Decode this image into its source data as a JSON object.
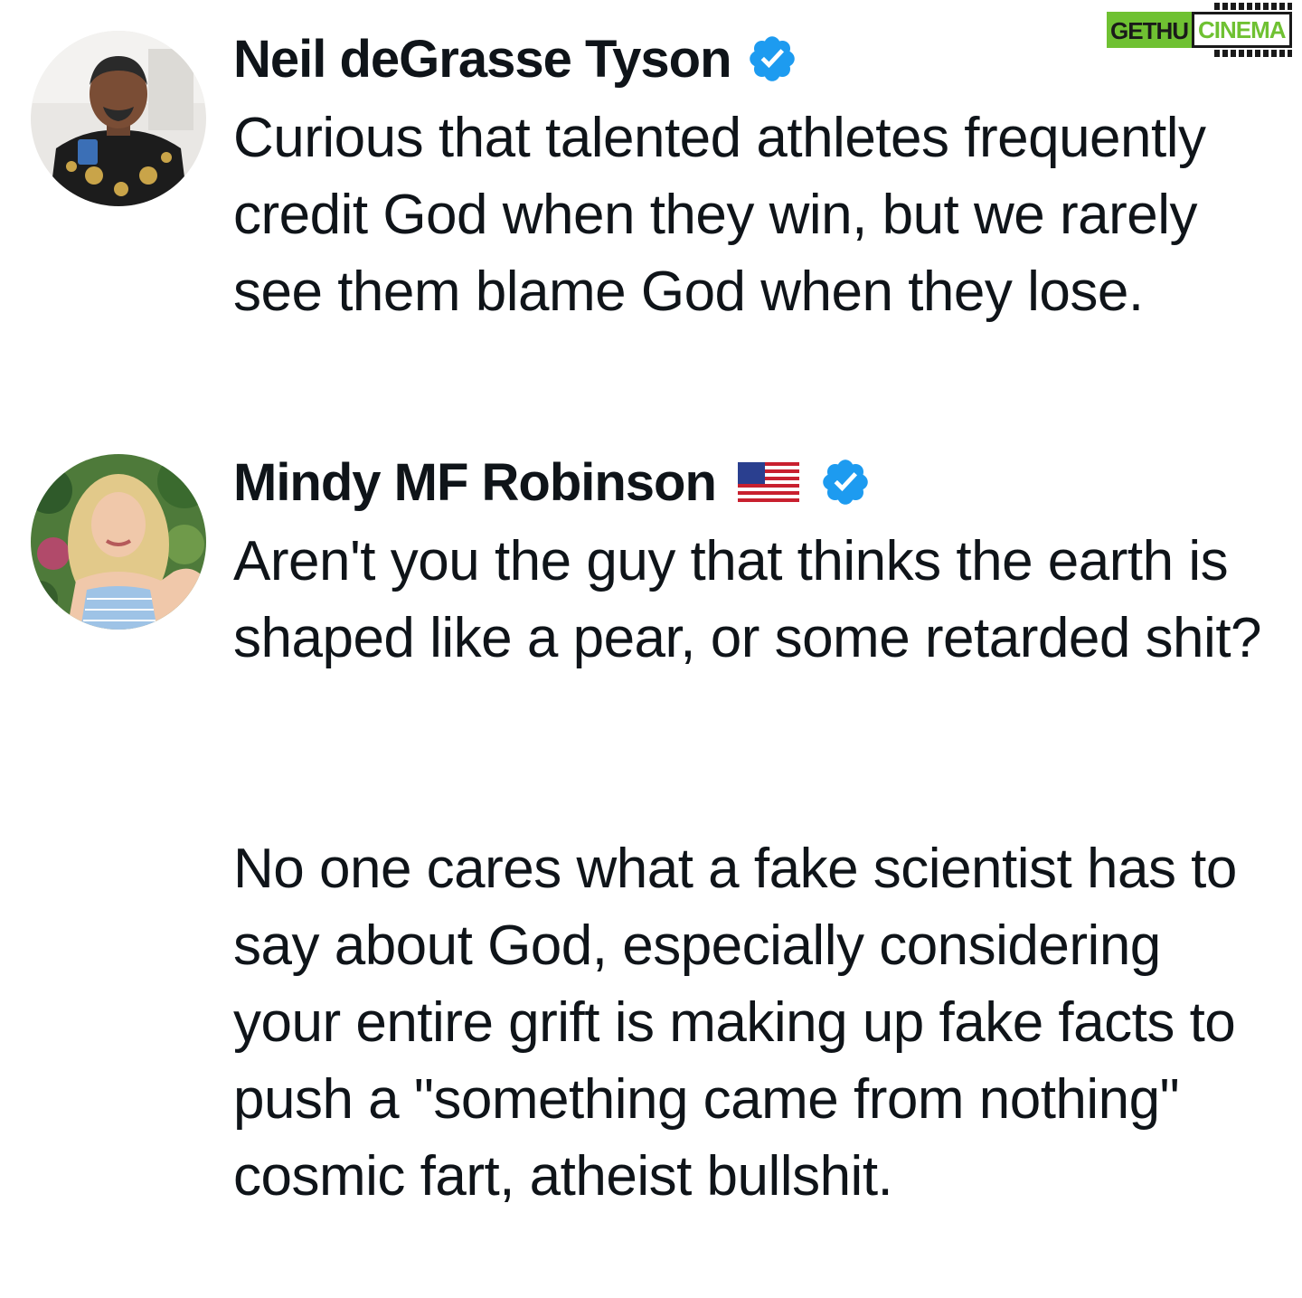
{
  "watermark": {
    "text_left": "GETHU",
    "text_right": "CINEMA"
  },
  "tweets": [
    {
      "author": "Neil deGrasse Tyson",
      "verified": true,
      "flag": null,
      "avatar": "neil-avatar",
      "paragraphs": [
        "Curious that talented athletes frequently credit God when they win, but we rarely see them blame God when they lose."
      ]
    },
    {
      "author": "Mindy MF Robinson",
      "verified": true,
      "flag": "us-flag",
      "avatar": "mindy-avatar",
      "paragraphs": [
        "Aren't you the guy that thinks the earth is shaped like a pear, or some retarded shit?",
        "No one cares what a fake scientist has to say about God, especially considering your entire grift is making up fake facts to push a \"something came from nothing\" cosmic fart, atheist bullshit."
      ]
    }
  ],
  "colors": {
    "text": "#0f1419",
    "verified_blue": "#1d9bf0",
    "logo_green": "#6fc132"
  }
}
